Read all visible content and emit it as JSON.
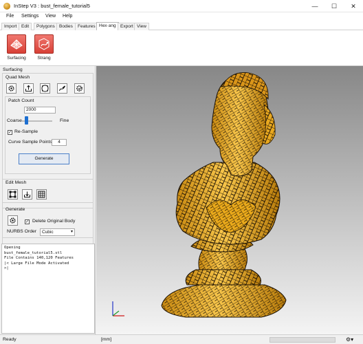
{
  "window": {
    "title": "InStep V3 : bust_female_tutorial5",
    "minimize_glyph": "—",
    "maximize_glyph": "☐",
    "close_glyph": "✕"
  },
  "menu": {
    "items": [
      "File",
      "Settings",
      "View",
      "Help"
    ]
  },
  "tabs": [
    {
      "label": "Import",
      "active": false
    },
    {
      "label": "Edit",
      "active": false
    },
    {
      "label": "Polygons",
      "active": false
    },
    {
      "label": "Bodies",
      "active": false
    },
    {
      "label": "Features",
      "active": false
    },
    {
      "label": "Hex·ang",
      "active": true
    },
    {
      "label": "Export",
      "active": false
    },
    {
      "label": "View",
      "active": false
    }
  ],
  "ribbon": {
    "surfacing_label": "Surfacing",
    "strang_label": "Strang",
    "button_color": "#e04a40"
  },
  "panel": {
    "title": "Surfacing",
    "quad_mesh": {
      "header": "Quad Mesh",
      "icons": [
        "gear-icon",
        "export-icon",
        "patch-outline-icon",
        "curve-draw-icon",
        "settings-gear-icon"
      ],
      "patch_count_label": "Patch Count",
      "patch_count_value": "2000",
      "slider_min_label": "Coarse",
      "slider_max_label": "Fine",
      "slider_level": 0.1,
      "resample_label": "Re-Sample",
      "resample_checked": true,
      "curve_sample_label": "Curve Sample Points",
      "curve_sample_value": "4",
      "generate_label": "Generate"
    },
    "edit_mesh": {
      "header": "Edit Mesh",
      "icons": [
        "node-edit-icon",
        "download-icon",
        "grid-icon"
      ]
    },
    "generate": {
      "header": "Generate",
      "delete_label": "Delete Original Body",
      "delete_checked": true,
      "nurbs_label": "NURBS Order",
      "nurbs_value": "Cubic"
    }
  },
  "log": {
    "lines": [
      "Opening",
      "bust_female_tutorial5.stl",
      "File Contains 140,120 Features",
      "|< Large File Mode Activated",
      ">|"
    ]
  },
  "status": {
    "ready": "Ready",
    "units": "[mm]",
    "settings_icon": "gear-dropdown-icon"
  },
  "colors": {
    "model_fill": "#f2b321",
    "model_edges": "#1a1004",
    "axis_x": "#d0181b",
    "axis_y": "#1e9a2b",
    "axis_z": "#2233c8"
  }
}
